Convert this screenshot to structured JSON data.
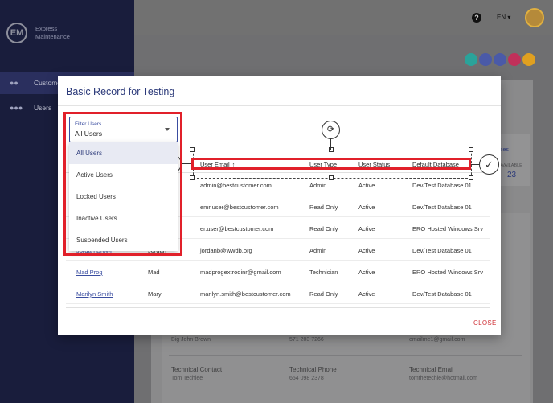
{
  "brand": {
    "line1": "Express",
    "line2": "Maintenance",
    "logo": "EM"
  },
  "sidebar": {
    "items": [
      {
        "label": "Customers",
        "icon": "people-icon"
      },
      {
        "label": "Users",
        "icon": "group-icon"
      }
    ]
  },
  "topbar": {
    "help": "?",
    "language": "EN ▾"
  },
  "action_buttons": [
    {
      "icon": "database-icon",
      "color": "#2aa39a"
    },
    {
      "icon": "layers-icon",
      "color": "#4a5aa8"
    },
    {
      "icon": "group-add-icon",
      "color": "#4a5aa8"
    },
    {
      "icon": "sitemap-icon",
      "color": "#c0305a"
    },
    {
      "icon": "edit-icon",
      "color": "#e0a020"
    }
  ],
  "bg_stats": {
    "label": "ses",
    "available_label": "AVAILABLE",
    "available_value": "23"
  },
  "bg_details": {
    "primary_name": "Big John Brown",
    "primary_phone": "571 203 7266",
    "primary_email": "emailme1@gmail.com",
    "technical_contact_label": "Technical Contact",
    "technical_contact_value": "Tom Techiee",
    "technical_phone_label": "Technical Phone",
    "technical_phone_value": "654 098 2378",
    "technical_email_label": "Technical Email",
    "technical_email_value": "tomthetechie@hotmail.com"
  },
  "modal": {
    "title": "Basic Record for Testing",
    "close_label": "CLOSE",
    "filter": {
      "label": "Filter Users",
      "value": "All Users",
      "options": [
        "All Users",
        "Active Users",
        "Locked Users",
        "Inactive Users",
        "Suspended Users"
      ]
    },
    "table": {
      "columns": [
        "User Email",
        "User Type",
        "User Status",
        "Default Database"
      ],
      "sort_indicator": "↑",
      "rows": [
        {
          "name": "",
          "first": "",
          "email": "admin@bestcustomer.com",
          "type": "Admin",
          "status": "Active",
          "db": "Dev/Test Database 01"
        },
        {
          "name": "",
          "first": "",
          "email": "emr.user@bestcustomer.com",
          "type": "Read Only",
          "status": "Active",
          "db": "Dev/Test Database 01"
        },
        {
          "name": "",
          "first": "",
          "email": "er.user@bestcustomer.com",
          "type": "Read Only",
          "status": "Active",
          "db": "ERO Hosted Windows Srv"
        },
        {
          "name": "Jordan Brown",
          "first": "Jordan",
          "email": "jordanb@wwdb.org",
          "type": "Admin",
          "status": "Active",
          "db": "Dev/Test Database 01"
        },
        {
          "name": "Mad Prog",
          "first": "Mad",
          "email": "madprogextrodinr@gmail.com",
          "type": "Technician",
          "status": "Active",
          "db": "ERO Hosted Windows Srv"
        },
        {
          "name": "Marilyn Smith",
          "first": "Mary",
          "email": "marilyn.smith@bestcustomer.com",
          "type": "Read Only",
          "status": "Active",
          "db": "Dev/Test Database 01"
        }
      ]
    }
  }
}
